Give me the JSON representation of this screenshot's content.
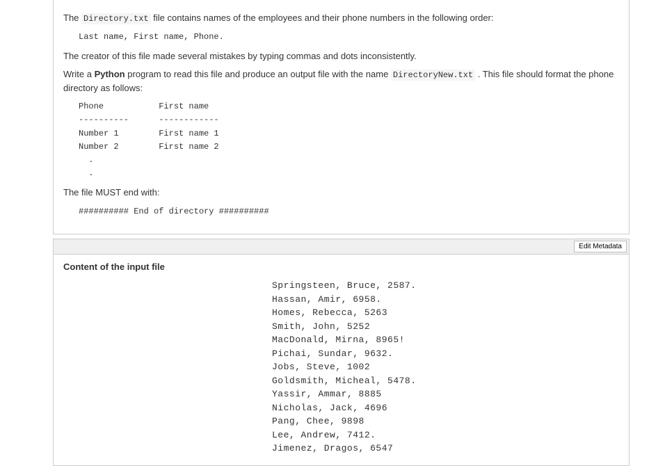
{
  "problem": {
    "line1_prefix": "The ",
    "line1_code": "Directory.txt",
    "line1_suffix": " file contains names of the employees and their phone numbers in the following order:",
    "format1": "Last name, First name, Phone.",
    "line2": "The creator of this file made several mistakes by typing commas and dots inconsistently.",
    "line3_prefix": "Write a ",
    "line3_bold": "Python",
    "line3_mid": " program to read this file and produce an output file with the name ",
    "line3_code": "DirectoryNew.txt",
    "line3_suffix": " . This file should format the phone directory as follows:",
    "table": "Phone           First name\n----------      ------------\nNumber 1        First name 1\nNumber 2        First name 2\n  .\n  .",
    "line4": "The file MUST end with:",
    "endline": "########## End of directory ##########"
  },
  "metadata": {
    "button": "Edit Metadata"
  },
  "input": {
    "heading": "Content of the input file",
    "data": "Springsteen, Bruce, 2587.\nHassan, Amir, 6958.\nHomes, Rebecca, 5263\nSmith, John, 5252\nMacDonald, Mirna, 8965!\nPichai, Sundar, 9632.\nJobs, Steve, 1002\nGoldsmith, Micheal, 5478.\nYassir, Ammar, 8885\nNicholas, Jack, 4696\nPang, Chee, 9898\nLee, Andrew, 7412.\nJimenez, Dragos, 6547"
  }
}
